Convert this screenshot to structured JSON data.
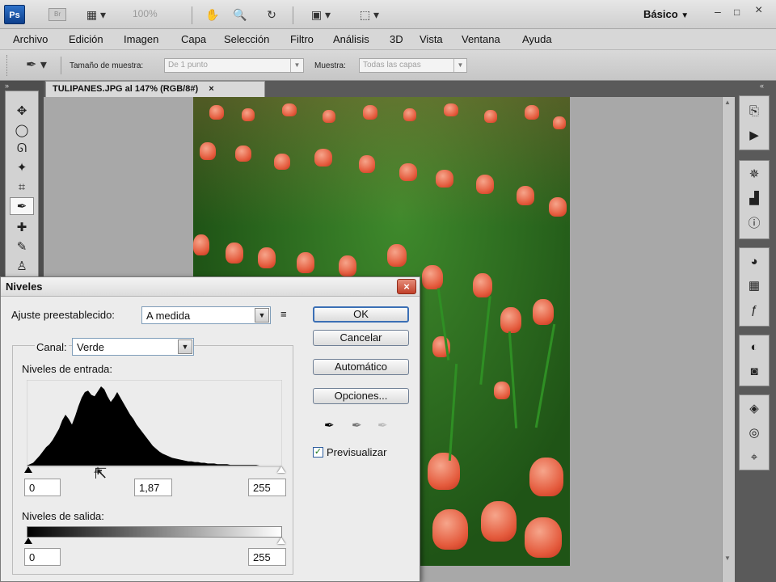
{
  "appbar": {
    "ps_logo": "Ps",
    "br_logo": "Br",
    "zoom": "100%",
    "workspace": "Básico",
    "minimize": "–",
    "maximize": "□",
    "close": "×"
  },
  "menu": [
    "Archivo",
    "Edición",
    "Imagen",
    "Capa",
    "Selección",
    "Filtro",
    "Análisis",
    "3D",
    "Vista",
    "Ventana",
    "Ayuda"
  ],
  "options": {
    "sample_size_label": "Tamaño de muestra:",
    "sample_size_value": "De 1 punto",
    "sample_label": "Muestra:",
    "sample_value": "Todas las capas"
  },
  "document": {
    "tab_title": "TULIPANES.JPG al 147% (RGB/8#)",
    "tab_close": "×"
  },
  "panels": {
    "collapse_left": "»",
    "collapse_right": "«"
  },
  "levels": {
    "title": "Niveles",
    "close": "×",
    "preset_label": "Ajuste preestablecido:",
    "preset_value": "A medida",
    "channel_label": "Canal:",
    "channel_value": "Verde",
    "input_label": "Niveles de entrada:",
    "input_black": "0",
    "input_gamma": "1,87",
    "input_white": "255",
    "output_label": "Niveles de salida:",
    "output_black": "0",
    "output_white": "255",
    "ok": "OK",
    "cancel": "Cancelar",
    "auto": "Automático",
    "options": "Opciones...",
    "preview_label": "Previsualizar",
    "preview_checked": true,
    "histogram": [
      0,
      2,
      4,
      9,
      14,
      20,
      26,
      30,
      36,
      44,
      52,
      64,
      72,
      66,
      58,
      70,
      84,
      96,
      104,
      106,
      100,
      98,
      105,
      112,
      108,
      98,
      90,
      96,
      104,
      96,
      88,
      80,
      72,
      66,
      58,
      52,
      46,
      40,
      34,
      28,
      24,
      20,
      17,
      15,
      13,
      11,
      10,
      9,
      8,
      7,
      6,
      6,
      5,
      5,
      4,
      4,
      3,
      3,
      3,
      2,
      2,
      2,
      2,
      1,
      1,
      1,
      1,
      1,
      1,
      1,
      1,
      1,
      0,
      0,
      0,
      0,
      0,
      0,
      0,
      0
    ]
  },
  "colors": {
    "accent": "#3b6fb5",
    "close_red": "#c2402a",
    "dialog_bg": "#ececec",
    "app_bg": "#5a5a5a"
  }
}
